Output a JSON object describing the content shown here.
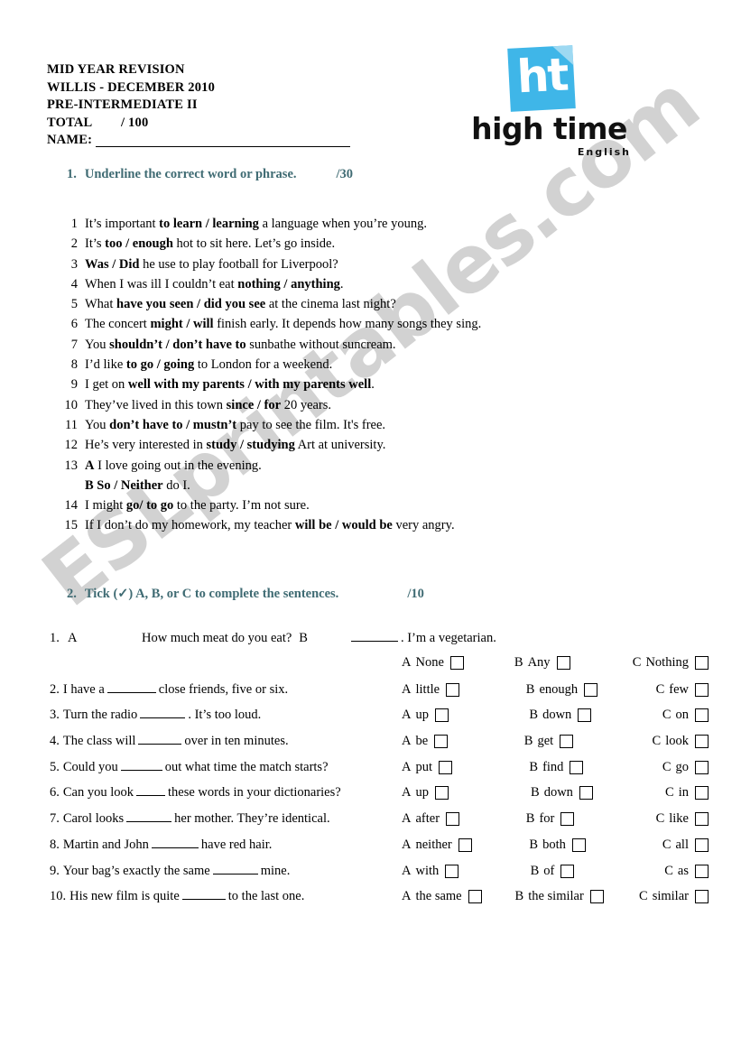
{
  "watermark": {
    "text": "ESLprintables.com"
  },
  "header": {
    "title": "MID YEAR REVISION",
    "subtitle": "WILLIS - DECEMBER 2010",
    "level": "PRE-INTERMEDIATE II",
    "total_label": "TOTAL",
    "total_value": "/ 100",
    "name_label": "NAME:"
  },
  "logo": {
    "mark_text": "ht",
    "word": "high time",
    "sub": "English",
    "brand_color": "#3fb6e8",
    "corner_color": "#9ed9f2"
  },
  "section1": {
    "number": "1.",
    "title": "Underline the correct word or phrase.",
    "score": "/30",
    "heading_color": "#3f6b73",
    "items": [
      {
        "num": "1",
        "parts": [
          {
            "t": "It’s important ",
            "b": false
          },
          {
            "t": "to learn / learning",
            "b": true
          },
          {
            "t": " a language when you’re young.",
            "b": false
          }
        ]
      },
      {
        "num": "2",
        "parts": [
          {
            "t": "It’s ",
            "b": false
          },
          {
            "t": "too / enough",
            "b": true
          },
          {
            "t": " hot to sit here. Let’s go inside.",
            "b": false
          }
        ]
      },
      {
        "num": "3",
        "parts": [
          {
            "t": "Was / Did",
            "b": true
          },
          {
            "t": " he use to play football for Liverpool?",
            "b": false
          }
        ]
      },
      {
        "num": "4",
        "parts": [
          {
            "t": "When I was ill I couldn’t eat ",
            "b": false
          },
          {
            "t": "nothing / anything",
            "b": true
          },
          {
            "t": ".",
            "b": false
          }
        ]
      },
      {
        "num": "5",
        "parts": [
          {
            "t": "What ",
            "b": false
          },
          {
            "t": "have you seen / did you see",
            "b": true
          },
          {
            "t": " at the cinema last night?",
            "b": false
          }
        ]
      },
      {
        "num": "6",
        "parts": [
          {
            "t": "The concert ",
            "b": false
          },
          {
            "t": "might / will",
            "b": true
          },
          {
            "t": " finish early. It depends how many songs they sing.",
            "b": false
          }
        ]
      },
      {
        "num": "7",
        "parts": [
          {
            "t": "You ",
            "b": false
          },
          {
            "t": "shouldn’t / don’t have to",
            "b": true
          },
          {
            "t": " sunbathe without suncream.",
            "b": false
          }
        ]
      },
      {
        "num": "8",
        "parts": [
          {
            "t": "I’d like ",
            "b": false
          },
          {
            "t": "to go / going",
            "b": true
          },
          {
            "t": " to London for a weekend.",
            "b": false
          }
        ]
      },
      {
        "num": "9",
        "parts": [
          {
            "t": "I get on ",
            "b": false
          },
          {
            "t": "well with my parents / with my parents well",
            "b": true
          },
          {
            "t": ".",
            "b": false
          }
        ]
      },
      {
        "num": "10",
        "parts": [
          {
            "t": "They’ve lived in this town ",
            "b": false
          },
          {
            "t": "since / for",
            "b": true
          },
          {
            "t": " 20 years.",
            "b": false
          }
        ]
      },
      {
        "num": "11",
        "parts": [
          {
            "t": "You ",
            "b": false
          },
          {
            "t": "don’t have to / mustn’t",
            "b": true
          },
          {
            "t": " pay to see the film. It's free.",
            "b": false
          }
        ]
      },
      {
        "num": "12",
        "parts": [
          {
            "t": "He’s very interested in ",
            "b": false
          },
          {
            "t": "study / studying",
            "b": true
          },
          {
            "t": " Art at university.",
            "b": false
          }
        ]
      },
      {
        "num": "13",
        "parts": [
          {
            "t": "A",
            "b": true
          },
          {
            "t": "  I love going out in the evening.",
            "b": false
          }
        ],
        "sub_parts": [
          {
            "t": "B",
            "b": true
          },
          {
            "t": "  ",
            "b": false
          },
          {
            "t": "So / Neither",
            "b": true
          },
          {
            "t": " do I.",
            "b": false
          }
        ]
      },
      {
        "num": "14",
        "parts": [
          {
            "t": "I might ",
            "b": false
          },
          {
            "t": "go/ to go",
            "b": true
          },
          {
            "t": " to the party. I’m not sure.",
            "b": false
          }
        ]
      },
      {
        "num": "15",
        "parts": [
          {
            "t": "If I don’t do my homework, my teacher ",
            "b": false
          },
          {
            "t": "will be / would be",
            "b": true
          },
          {
            "t": " very angry.",
            "b": false
          }
        ]
      }
    ]
  },
  "section2": {
    "number": "2.",
    "title": "Tick (✓) A, B, or C to complete the sentences.",
    "score": "/10",
    "heading_color": "#3f6b73",
    "dialogue": {
      "num": "1.",
      "speaker_a": "A",
      "question_a": "How much meat do you eat?",
      "speaker_b": "B",
      "question_b": ". I’m a vegetarian."
    },
    "rows": [
      {
        "num": "",
        "before": "",
        "after": "",
        "options": [
          {
            "letter": "A",
            "label": "None"
          },
          {
            "letter": "B",
            "label": "Any"
          },
          {
            "letter": "C",
            "label": "Nothing"
          }
        ]
      },
      {
        "num": "2.",
        "before": "I have a",
        "after": "close friends, five or six.",
        "options": [
          {
            "letter": "A",
            "label": "little"
          },
          {
            "letter": "B",
            "label": "enough"
          },
          {
            "letter": "C",
            "label": "few"
          }
        ]
      },
      {
        "num": "3.",
        "before": "Turn the radio",
        "after": ". It’s too loud.",
        "options": [
          {
            "letter": "A",
            "label": "up"
          },
          {
            "letter": "B",
            "label": "down"
          },
          {
            "letter": "C",
            "label": "on"
          }
        ]
      },
      {
        "num": "4.",
        "before": "The class will",
        "after": "over in ten minutes.",
        "options": [
          {
            "letter": "A",
            "label": "be"
          },
          {
            "letter": "B",
            "label": "get"
          },
          {
            "letter": "C",
            "label": "look"
          }
        ]
      },
      {
        "num": "5.",
        "before": "Could you",
        "after": "out what time the match starts?",
        "options": [
          {
            "letter": "A",
            "label": "put"
          },
          {
            "letter": "B",
            "label": "find"
          },
          {
            "letter": "C",
            "label": "go"
          }
        ]
      },
      {
        "num": "6.",
        "before": "Can you look",
        "after": "these words in your dictionaries?",
        "options": [
          {
            "letter": "A",
            "label": "up"
          },
          {
            "letter": "B",
            "label": "down"
          },
          {
            "letter": "C",
            "label": "in"
          }
        ]
      },
      {
        "num": "7.",
        "before": "Carol looks",
        "after": "her mother. They’re identical.",
        "options": [
          {
            "letter": "A",
            "label": "after"
          },
          {
            "letter": "B",
            "label": "for"
          },
          {
            "letter": "C",
            "label": "like"
          }
        ]
      },
      {
        "num": "8.",
        "before": "Martin and John",
        "after": "have red hair.",
        "options": [
          {
            "letter": "A",
            "label": "neither"
          },
          {
            "letter": "B",
            "label": "both"
          },
          {
            "letter": "C",
            "label": "all"
          }
        ]
      },
      {
        "num": "9.",
        "before": "Your bag’s exactly the same",
        "after": "mine.",
        "options": [
          {
            "letter": "A",
            "label": "with"
          },
          {
            "letter": "B",
            "label": "of"
          },
          {
            "letter": "C",
            "label": "as"
          }
        ]
      },
      {
        "num": "10.",
        "before": "His new film is quite",
        "after": "to the last one.",
        "options": [
          {
            "letter": "A",
            "label": "the same"
          },
          {
            "letter": "B",
            "label": "the similar"
          },
          {
            "letter": "C",
            "label": "similar"
          }
        ]
      }
    ]
  }
}
